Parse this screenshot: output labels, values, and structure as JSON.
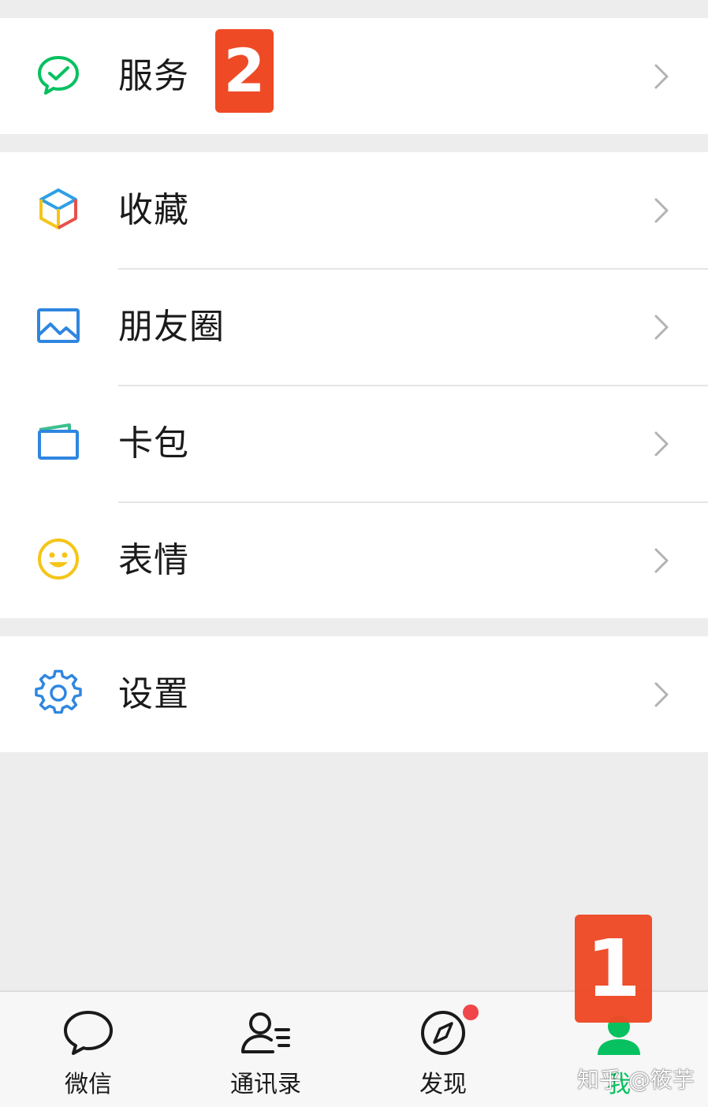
{
  "menu_groups": [
    {
      "items": [
        {
          "icon": "services-icon",
          "label": "服务"
        }
      ]
    },
    {
      "items": [
        {
          "icon": "favorites-icon",
          "label": "收藏"
        },
        {
          "icon": "moments-icon",
          "label": "朋友圈"
        },
        {
          "icon": "card-wallet-icon",
          "label": "卡包"
        },
        {
          "icon": "stickers-icon",
          "label": "表情"
        }
      ]
    },
    {
      "items": [
        {
          "icon": "settings-icon",
          "label": "设置"
        }
      ]
    }
  ],
  "annotations": {
    "step1": "1",
    "step2": "2"
  },
  "tabbar": {
    "tabs": [
      {
        "icon": "chat-icon",
        "label": "微信"
      },
      {
        "icon": "contacts-icon",
        "label": "通讯录"
      },
      {
        "icon": "discover-icon",
        "label": "发现",
        "has_dot": true
      },
      {
        "icon": "me-icon",
        "label": "我",
        "active": true
      }
    ]
  },
  "watermark": "知乎 @筱芋",
  "colors": {
    "accent": "#07c160",
    "badge": "#ef4a26",
    "dot": "#f0464a"
  }
}
